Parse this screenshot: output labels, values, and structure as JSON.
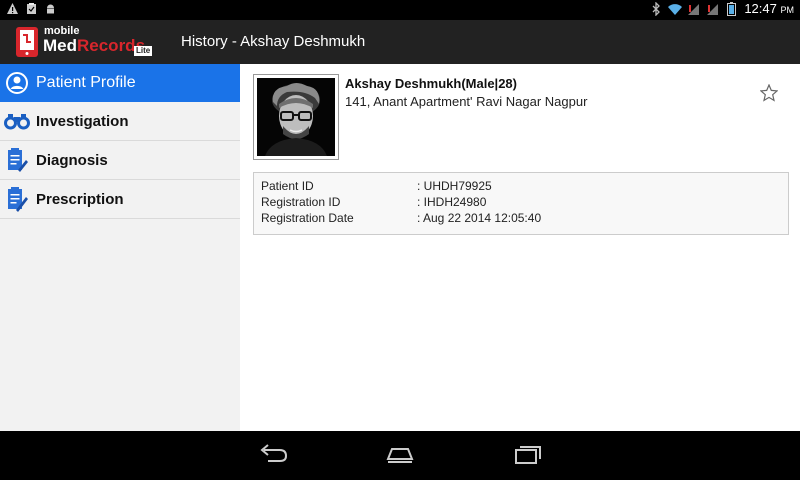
{
  "status_bar": {
    "left_icons": [
      "warning-icon",
      "clipboard-icon",
      "android-icon"
    ],
    "right_icons": [
      "bluetooth-icon",
      "wifi-icon",
      "signal-1-icon",
      "signal-2-icon",
      "battery-icon"
    ],
    "time": "12:47",
    "ampm": "PM"
  },
  "action_bar": {
    "logo": {
      "line1": "mobile",
      "line2_a": "Med",
      "line2_b": "Records",
      "badge": "Lite"
    },
    "title": "History - Akshay  Deshmukh"
  },
  "sidebar": {
    "items": [
      {
        "label": "Patient Profile",
        "icon": "user-circle-icon",
        "active": true
      },
      {
        "label": "Investigation",
        "icon": "binoculars-icon",
        "active": false
      },
      {
        "label": "Diagnosis",
        "icon": "clipboard-pen-icon",
        "active": false
      },
      {
        "label": "Prescription",
        "icon": "prescription-pen-icon",
        "active": false
      }
    ]
  },
  "patient": {
    "name": "Akshay  Deshmukh(Male|28)",
    "address": "141, Anant Apartment' Ravi Nagar Nagpur",
    "details": [
      {
        "label": "Patient ID",
        "value": ": UHDH79925"
      },
      {
        "label": "Registration ID",
        "value": ": IHDH24980"
      },
      {
        "label": "Registration Date",
        "value": ": Aug 22 2014 12:05:40"
      }
    ]
  },
  "nav_bar": {
    "buttons": [
      "back-icon",
      "home-icon",
      "recents-icon"
    ]
  },
  "colors": {
    "accent": "#1a73e8",
    "logo_red": "#d8262c",
    "action_bar": "#222222"
  }
}
